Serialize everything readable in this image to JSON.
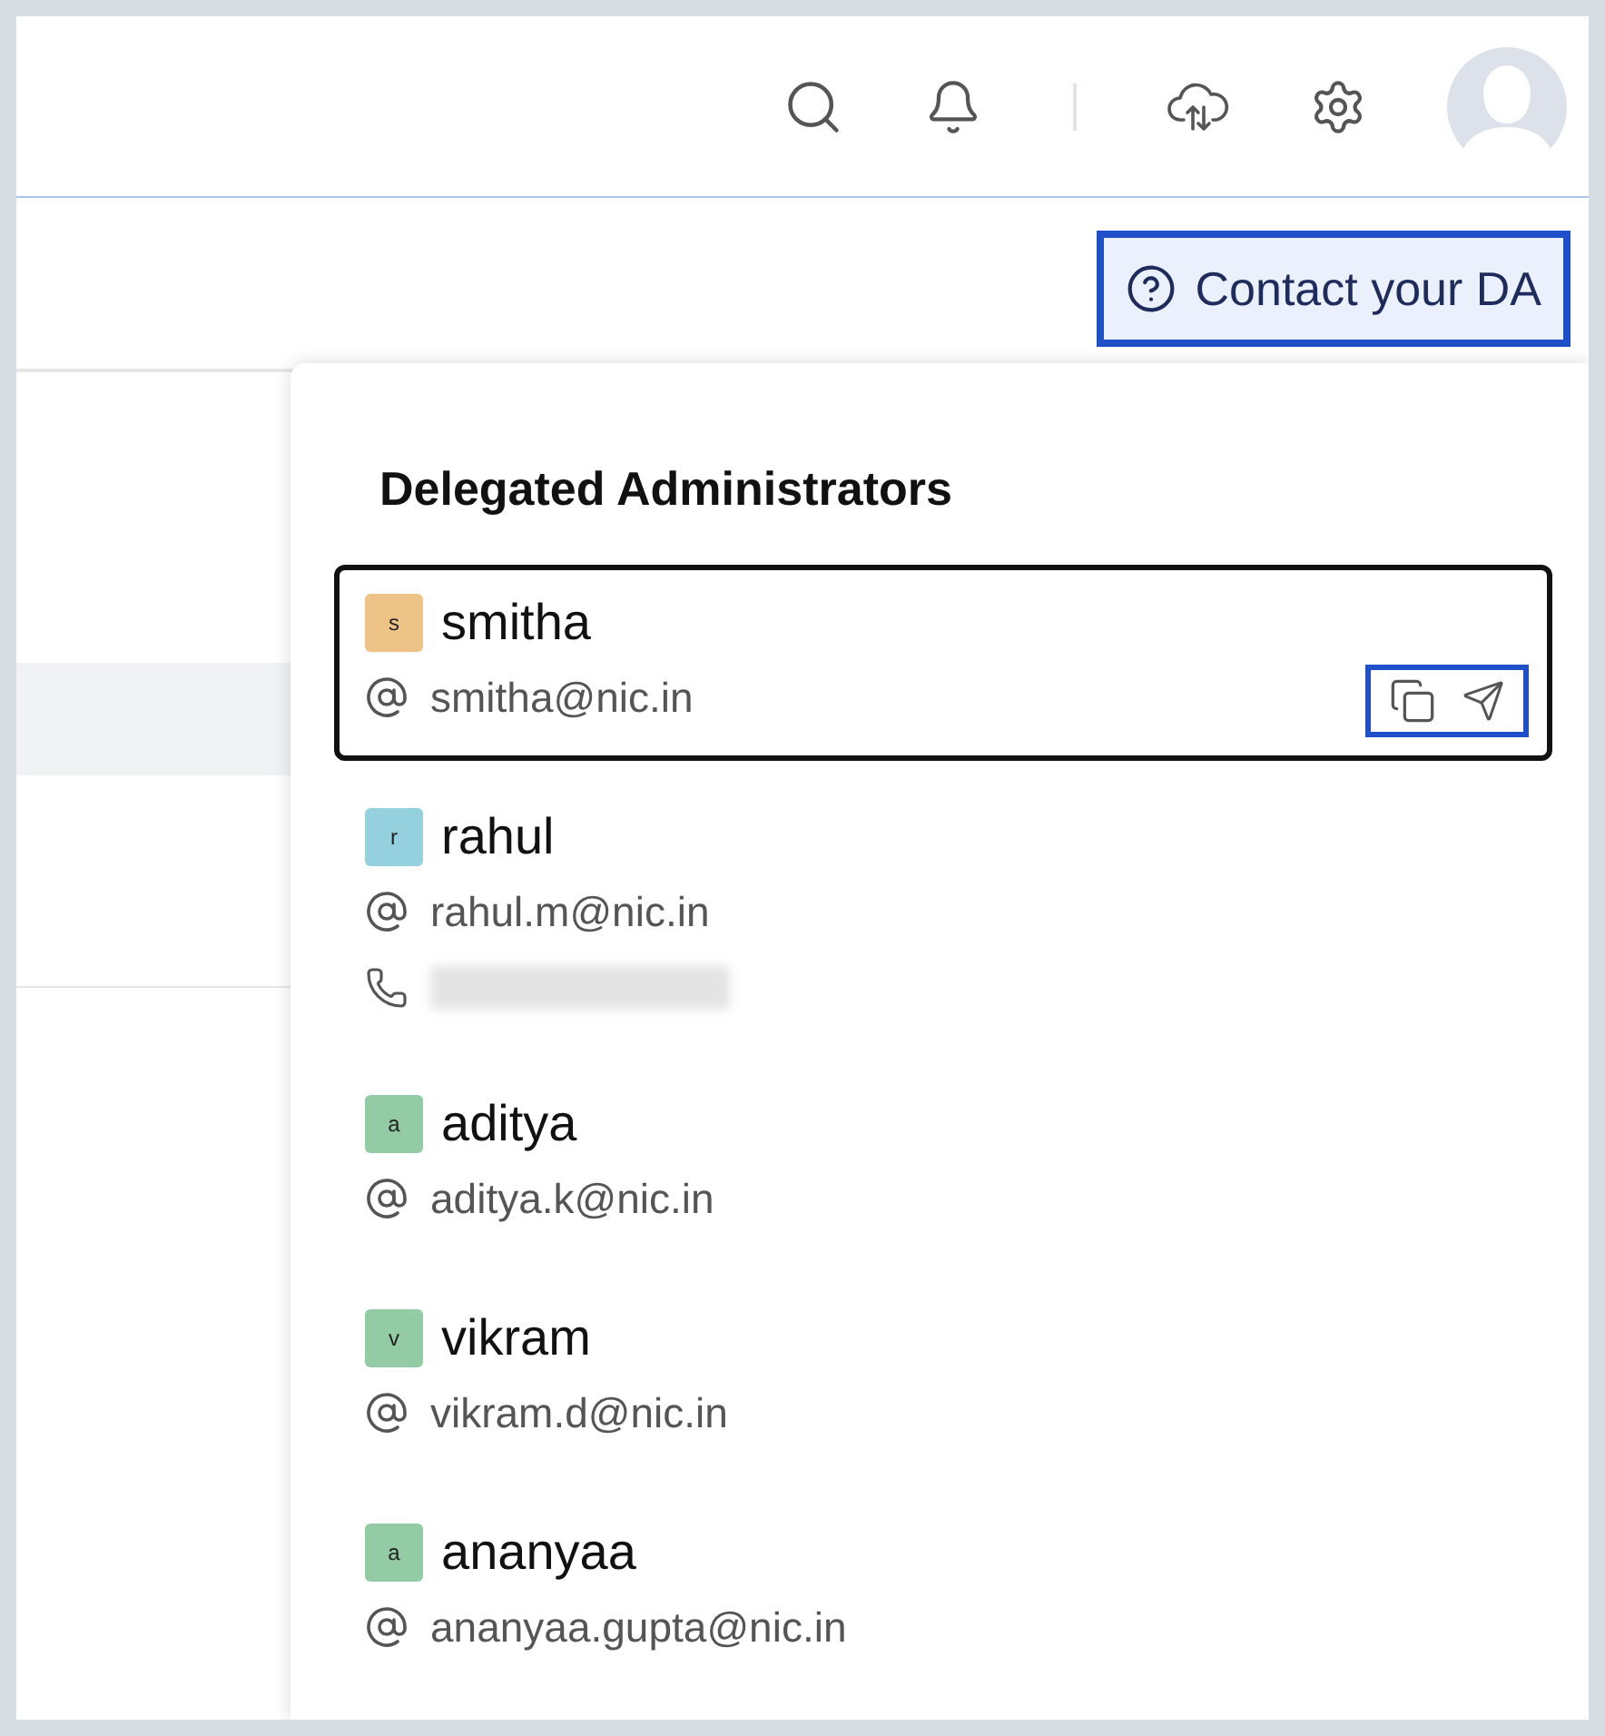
{
  "header": {
    "icons": [
      {
        "kind": "search"
      },
      {
        "kind": "bell"
      },
      {
        "kind": "cloud-sync"
      },
      {
        "kind": "settings"
      },
      {
        "kind": "avatar"
      }
    ]
  },
  "contact_button": {
    "label": "Contact your DA",
    "highlighted": true
  },
  "panel": {
    "title": "Delegated Administrators",
    "admins": [
      {
        "initial": "s",
        "name": "smitha",
        "email": "smitha@nic.in",
        "color": "#eec388",
        "selected": true,
        "phone_redacted": false
      },
      {
        "initial": "r",
        "name": "rahul",
        "email": "rahul.m@nic.in",
        "color": "#94d0dd",
        "selected": false,
        "phone_redacted": true
      },
      {
        "initial": "a",
        "name": "aditya",
        "email": "aditya.k@nic.in",
        "color": "#93cca4",
        "selected": false,
        "phone_redacted": false
      },
      {
        "initial": "v",
        "name": "vikram",
        "email": "vikram.d@nic.in",
        "color": "#93cca4",
        "selected": false,
        "phone_redacted": false
      },
      {
        "initial": "a",
        "name": "ananyaa",
        "email": "ananyaa.gupta@nic.in",
        "color": "#93cca4",
        "selected": false,
        "phone_redacted": false
      }
    ]
  }
}
